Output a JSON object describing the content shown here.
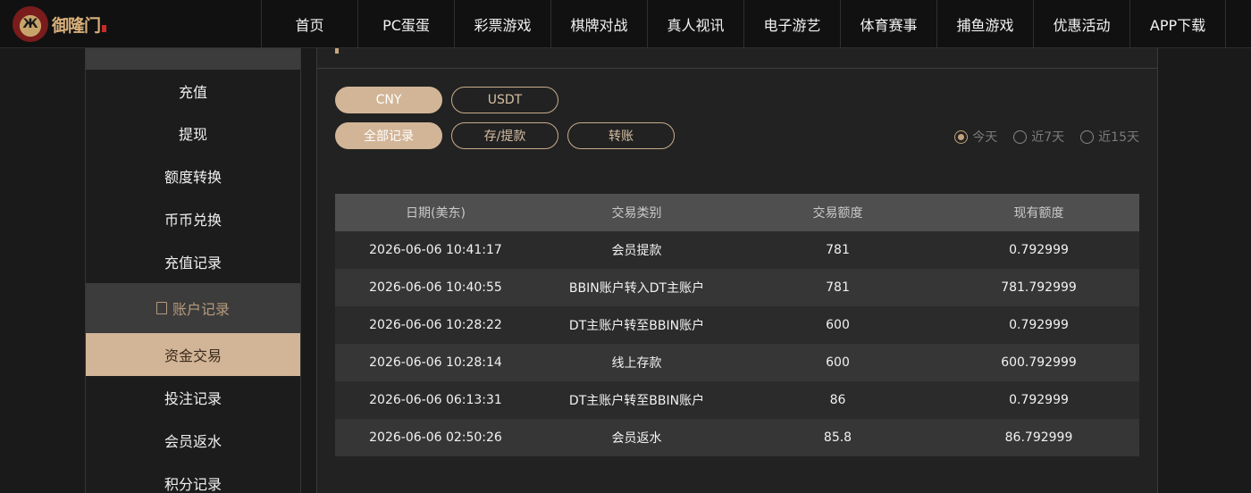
{
  "logo": {
    "text": "御隆门"
  },
  "nav": [
    "首页",
    "PC蛋蛋",
    "彩票游戏",
    "棋牌对战",
    "真人视讯",
    "电子游艺",
    "体育赛事",
    "捕鱼游戏",
    "优惠活动",
    "APP下载"
  ],
  "sidebar": {
    "items_top": [
      "充值",
      "提现",
      "额度转换",
      "币币兑换",
      "充值记录"
    ],
    "section": "账户记录",
    "items_bottom": [
      "资金交易",
      "投注记录",
      "会员返水",
      "积分记录"
    ],
    "active": "资金交易"
  },
  "currency_tabs": [
    "CNY",
    "USDT"
  ],
  "filter_tabs": [
    "全部记录",
    "存/提款",
    "转账"
  ],
  "date_filters": [
    "今天",
    "近7天",
    "近15天"
  ],
  "table": {
    "headers": [
      "日期(美东)",
      "交易类别",
      "交易额度",
      "现有额度"
    ],
    "rows": [
      [
        "2026-06-06 10:41:17",
        "会员提款",
        "781",
        "0.792999"
      ],
      [
        "2026-06-06 10:40:55",
        "BBIN账户转入DT主账户",
        "781",
        "781.792999"
      ],
      [
        "2026-06-06 10:28:22",
        "DT主账户转至BBIN账户",
        "600",
        "0.792999"
      ],
      [
        "2026-06-06 10:28:14",
        "线上存款",
        "600",
        "600.792999"
      ],
      [
        "2026-06-06 06:13:31",
        "DT主账户转至BBIN账户",
        "86",
        "0.792999"
      ],
      [
        "2026-06-06 02:50:26",
        "会员返水",
        "85.8",
        "86.792999"
      ]
    ]
  },
  "colors": {
    "accent": "#d2b597",
    "amount": "#e0383a",
    "background": "#1a1a1a"
  }
}
